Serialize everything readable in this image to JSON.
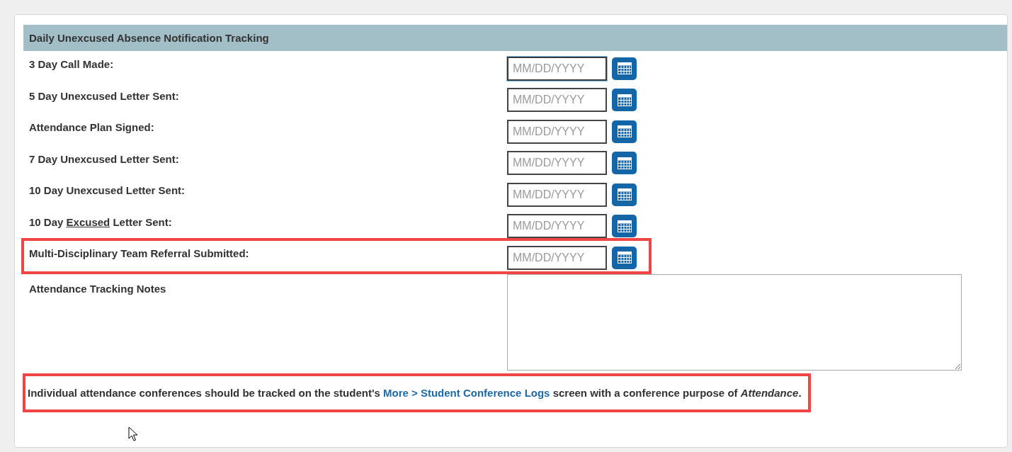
{
  "section": {
    "title": "Daily Unexcused Absence Notification Tracking"
  },
  "rows": [
    {
      "label": "3 Day Call Made:",
      "placeholder": "MM/DD/YYYY",
      "focused": true,
      "highlighted": false
    },
    {
      "label": "5 Day Unexcused Letter Sent:",
      "placeholder": "MM/DD/YYYY",
      "focused": false,
      "highlighted": false
    },
    {
      "label": "Attendance Plan Signed:",
      "placeholder": "MM/DD/YYYY",
      "focused": false,
      "highlighted": false
    },
    {
      "label": "7 Day Unexcused Letter Sent:",
      "placeholder": "MM/DD/YYYY",
      "focused": false,
      "highlighted": false
    },
    {
      "label": "10 Day Unexcused Letter Sent:",
      "placeholder": "MM/DD/YYYY",
      "focused": false,
      "highlighted": false
    },
    {
      "label": "10 Day ",
      "label_underlined": "Excused",
      "label_after": " Letter Sent:",
      "placeholder": "MM/DD/YYYY",
      "focused": false,
      "highlighted": false
    },
    {
      "label": "Multi-Disciplinary Team Referral Submitted:",
      "placeholder": "MM/DD/YYYY",
      "focused": false,
      "highlighted": true
    }
  ],
  "notes": {
    "label": "Attendance Tracking Notes"
  },
  "info": {
    "text_before": "Individual attendance conferences should be tracked on the student's ",
    "link": "More > Student Conference Logs",
    "text_after": " screen with a conference purpose of *Attendance*.",
    "highlighted": true
  }
}
